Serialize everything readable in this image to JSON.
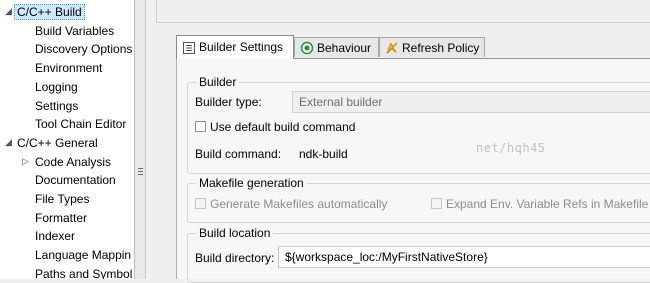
{
  "sidebar": {
    "items": [
      {
        "label": "C/C++ Build",
        "level": 0,
        "expanded": true,
        "selected": true
      },
      {
        "label": "Build Variables",
        "level": 1
      },
      {
        "label": "Discovery Options",
        "level": 1
      },
      {
        "label": "Environment",
        "level": 1
      },
      {
        "label": "Logging",
        "level": 1
      },
      {
        "label": "Settings",
        "level": 1
      },
      {
        "label": "Tool Chain Editor",
        "level": 1
      },
      {
        "label": "C/C++ General",
        "level": 0,
        "expanded": true
      },
      {
        "label": "Code Analysis",
        "level": 1,
        "collapsed": true
      },
      {
        "label": "Documentation",
        "level": 1
      },
      {
        "label": "File Types",
        "level": 1
      },
      {
        "label": "Formatter",
        "level": 1
      },
      {
        "label": "Indexer",
        "level": 1
      },
      {
        "label": "Language Mappin",
        "level": 1
      },
      {
        "label": "Paths and Symbol",
        "level": 1
      }
    ]
  },
  "tabs": [
    {
      "label": "Builder Settings",
      "icon": "builder-settings-icon",
      "active": true
    },
    {
      "label": "Behaviour",
      "icon": "behaviour-icon"
    },
    {
      "label": "Refresh Policy",
      "icon": "refresh-policy-icon"
    }
  ],
  "builder": {
    "group_title": "Builder",
    "type_label": "Builder type:",
    "type_value": "External builder",
    "use_default_label": "Use default build command",
    "use_default_checked": false,
    "command_label": "Build command:",
    "command_value": "ndk-build"
  },
  "makefile": {
    "group_title": "Makefile generation",
    "generate_label": "Generate Makefiles automatically",
    "expand_label": "Expand Env. Variable Refs in Makefile"
  },
  "location": {
    "group_title": "Build location",
    "dir_label": "Build directory:",
    "dir_value": "${workspace_loc:/MyFirstNativeStore}"
  },
  "watermark": "net/hqh45",
  "colors": {
    "selection": "#cde8ff",
    "panel": "#f7f7f7",
    "window": "#f0f0f0"
  }
}
